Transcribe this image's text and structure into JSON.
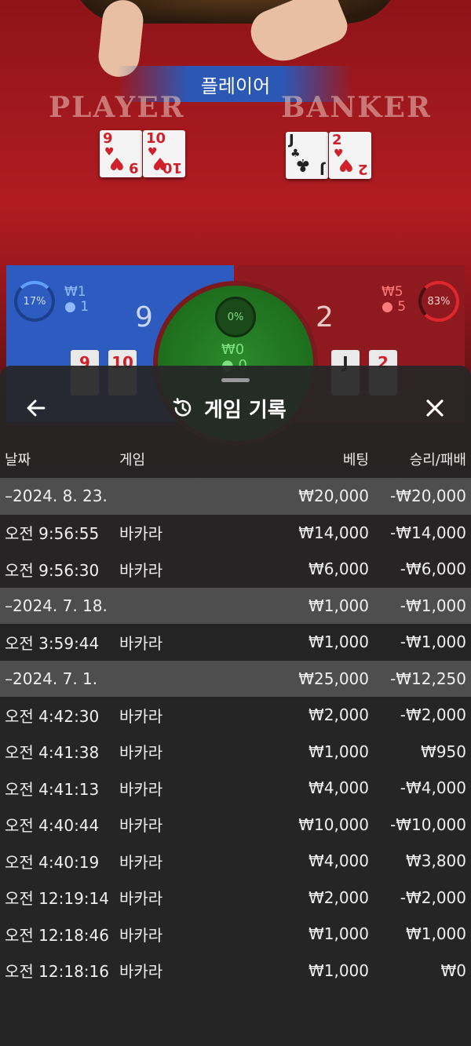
{
  "game": {
    "result_banner": "플레이어",
    "player_title": "PLAYER",
    "banker_title": "BANKER",
    "player_cards": [
      {
        "rank": "9",
        "suit": "♥",
        "color": "red"
      },
      {
        "rank": "10",
        "suit": "♥",
        "color": "red"
      }
    ],
    "banker_cards": [
      {
        "rank": "J",
        "suit": "♣",
        "color": "black"
      },
      {
        "rank": "2",
        "suit": "♥",
        "color": "red"
      }
    ],
    "player_percent": "17%",
    "player_amount": "₩1",
    "player_count": "1",
    "player_score": "9",
    "banker_percent": "83%",
    "banker_amount": "₩5",
    "banker_count": "5",
    "banker_score": "2",
    "tie_percent": "0%",
    "tie_amount": "₩0",
    "tie_count": "0",
    "player_mini_cards": [
      "9",
      "10"
    ],
    "banker_mini_cards": [
      "J",
      "2"
    ]
  },
  "history": {
    "title": "게임 기록",
    "back_icon": "arrow-left-icon",
    "history_icon": "history-clock-icon",
    "close_icon": "close-icon",
    "columns": {
      "date": "날짜",
      "game": "게임",
      "bet": "베팅",
      "result": "승리/패배"
    },
    "rows": [
      {
        "type": "date",
        "date": "–2024. 8. 23.",
        "game": "",
        "bet": "₩20,000",
        "result": "-₩20,000"
      },
      {
        "type": "entry",
        "date": "오전 9:56:55",
        "game": "바카라",
        "bet": "₩14,000",
        "result": "-₩14,000"
      },
      {
        "type": "entry",
        "date": "오전 9:56:30",
        "game": "바카라",
        "bet": "₩6,000",
        "result": "-₩6,000"
      },
      {
        "type": "date",
        "date": "–2024. 7. 18.",
        "game": "",
        "bet": "₩1,000",
        "result": "-₩1,000"
      },
      {
        "type": "entry",
        "date": "오전 3:59:44",
        "game": "바카라",
        "bet": "₩1,000",
        "result": "-₩1,000"
      },
      {
        "type": "date",
        "date": "–2024. 7. 1.",
        "game": "",
        "bet": "₩25,000",
        "result": "-₩12,250"
      },
      {
        "type": "entry",
        "date": "오전 4:42:30",
        "game": "바카라",
        "bet": "₩2,000",
        "result": "-₩2,000"
      },
      {
        "type": "entry",
        "date": "오전 4:41:38",
        "game": "바카라",
        "bet": "₩1,000",
        "result": "₩950"
      },
      {
        "type": "entry",
        "date": "오전 4:41:13",
        "game": "바카라",
        "bet": "₩4,000",
        "result": "-₩4,000"
      },
      {
        "type": "entry",
        "date": "오전 4:40:44",
        "game": "바카라",
        "bet": "₩10,000",
        "result": "-₩10,000"
      },
      {
        "type": "entry",
        "date": "오전 4:40:19",
        "game": "바카라",
        "bet": "₩4,000",
        "result": "₩3,800"
      },
      {
        "type": "entry",
        "date": "오전 12:19:14",
        "game": "바카라",
        "bet": "₩2,000",
        "result": "-₩2,000"
      },
      {
        "type": "entry",
        "date": "오전 12:18:46",
        "game": "바카라",
        "bet": "₩1,000",
        "result": "₩1,000"
      },
      {
        "type": "entry",
        "date": "오전 12:18:16",
        "game": "바카라",
        "bet": "₩1,000",
        "result": "₩0"
      }
    ]
  }
}
